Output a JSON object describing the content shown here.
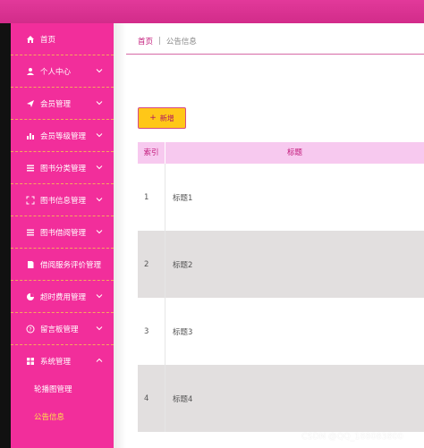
{
  "colors": {
    "topbar": "#d93091",
    "sidebar": "#f22e9b",
    "sidebar_divider": "#f6a95d",
    "active_sub": "#ffe24a",
    "add_button": "#ffc718",
    "table_header": "#f7c9ef",
    "row_alt": "#e2dfdf"
  },
  "sidebar": {
    "items": [
      {
        "label": "首页",
        "icon": "home-icon",
        "chevron": false
      },
      {
        "label": "个人中心",
        "icon": "user-icon",
        "chevron": true
      },
      {
        "label": "会员管理",
        "icon": "send-icon",
        "chevron": true
      },
      {
        "label": "会员等级管理",
        "icon": "bar-chart-icon",
        "chevron": true
      },
      {
        "label": "图书分类管理",
        "icon": "list-icon",
        "chevron": true
      },
      {
        "label": "图书信息管理",
        "icon": "expand-icon",
        "chevron": true
      },
      {
        "label": "图书借阅管理",
        "icon": "list-icon",
        "chevron": true
      },
      {
        "label": "借阅服务评价管理",
        "icon": "document-icon",
        "chevron": false
      },
      {
        "label": "超时费用管理",
        "icon": "pie-icon",
        "chevron": true
      },
      {
        "label": "留言板管理",
        "icon": "help-icon",
        "chevron": true
      },
      {
        "label": "系统管理",
        "icon": "grid-icon",
        "chevron": true,
        "expanded": true
      }
    ],
    "sub_items": [
      {
        "label": "轮播图管理",
        "active": false
      },
      {
        "label": "公告信息",
        "active": true
      }
    ]
  },
  "breadcrumb": {
    "home": "首页",
    "separator": "|",
    "current": "公告信息"
  },
  "toolbar": {
    "add_label": "新增",
    "add_icon": "plus-icon"
  },
  "table": {
    "headers": {
      "index": "索引",
      "title": "标题"
    },
    "rows": [
      {
        "index": "1",
        "title": "标题1"
      },
      {
        "index": "2",
        "title": "标题2"
      },
      {
        "index": "3",
        "title": "标题3"
      },
      {
        "index": "4",
        "title": "标题4"
      }
    ]
  },
  "watermark": "CSDN @QQ_188083800"
}
